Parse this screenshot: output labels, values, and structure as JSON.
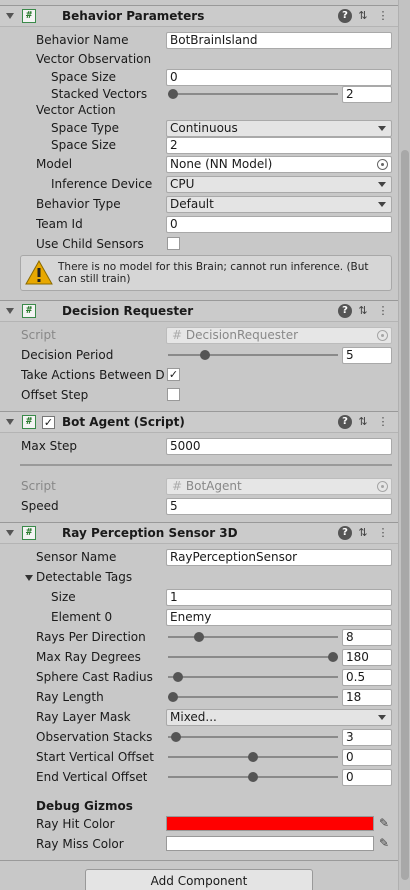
{
  "behavior_parameters": {
    "title": "Behavior Parameters",
    "behavior_name_label": "Behavior Name",
    "behavior_name_value": "BotBrainIsland",
    "vector_observation_label": "Vector Observation",
    "space_size_label": "Space Size",
    "obs_space_size_value": "0",
    "stacked_vectors_label": "Stacked Vectors",
    "stacked_vectors_value": "2",
    "stacked_vectors_slider": 0.0,
    "vector_action_label": "Vector Action",
    "space_type_label": "Space Type",
    "space_type_value": "Continuous",
    "act_space_size_label": "Space Size",
    "act_space_size_value": "2",
    "model_label": "Model",
    "model_value": "None (NN Model)",
    "inference_device_label": "Inference Device",
    "inference_device_value": "CPU",
    "behavior_type_label": "Behavior Type",
    "behavior_type_value": "Default",
    "team_id_label": "Team Id",
    "team_id_value": "0",
    "use_child_sensors_label": "Use Child Sensors",
    "use_child_sensors_checked": false,
    "warning_text": "There is no model for this Brain; cannot run inference. (But can still train)"
  },
  "decision_requester": {
    "title": "Decision Requester",
    "script_label": "Script",
    "script_value": "DecisionRequester",
    "decision_period_label": "Decision Period",
    "decision_period_value": "5",
    "decision_period_slider": 0.2,
    "take_actions_label": "Take Actions Between De",
    "take_actions_checked": true,
    "take_actions_check_glyph": "✓",
    "offset_step_label": "Offset Step",
    "offset_step_checked": false
  },
  "bot_agent": {
    "title": "Bot Agent (Script)",
    "enabled_glyph": "✓",
    "max_step_label": "Max Step",
    "max_step_value": "5000",
    "script_label": "Script",
    "script_value": "BotAgent",
    "speed_label": "Speed",
    "speed_value": "5"
  },
  "ray_perception": {
    "title": "Ray Perception Sensor 3D",
    "sensor_name_label": "Sensor Name",
    "sensor_name_value": "RayPerceptionSensor",
    "detectable_tags_label": "Detectable Tags",
    "size_label": "Size",
    "size_value": "1",
    "element0_label": "Element 0",
    "element0_value": "Enemy",
    "rays_per_direction_label": "Rays Per Direction",
    "rays_per_direction_value": "8",
    "rays_per_direction_slider": 0.16,
    "max_ray_degrees_label": "Max Ray Degrees",
    "max_ray_degrees_value": "180",
    "max_ray_degrees_slider": 1.0,
    "sphere_cast_radius_label": "Sphere Cast Radius",
    "sphere_cast_radius_value": "0.5",
    "sphere_cast_radius_slider": 0.03,
    "ray_length_label": "Ray Length",
    "ray_length_value": "18",
    "ray_length_slider": 0.0,
    "ray_layer_mask_label": "Ray Layer Mask",
    "ray_layer_mask_value": "Mixed...",
    "observation_stacks_label": "Observation Stacks",
    "observation_stacks_value": "3",
    "observation_stacks_slider": 0.02,
    "start_vertical_offset_label": "Start Vertical Offset",
    "start_vertical_offset_value": "0",
    "start_vertical_offset_slider": 0.5,
    "end_vertical_offset_label": "End Vertical Offset",
    "end_vertical_offset_value": "0",
    "end_vertical_offset_slider": 0.5,
    "debug_gizmos_label": "Debug Gizmos",
    "ray_hit_color_label": "Ray Hit Color",
    "ray_hit_color": "#ff0000",
    "ray_miss_color_label": "Ray Miss Color",
    "ray_miss_color": "#ffffff"
  },
  "header_icons": {
    "script_glyph": "#",
    "help_glyph": "?",
    "settings_glyph": "⇅",
    "more_glyph": "⋮",
    "eyedropper_glyph": "✎"
  },
  "add_component_label": "Add Component"
}
